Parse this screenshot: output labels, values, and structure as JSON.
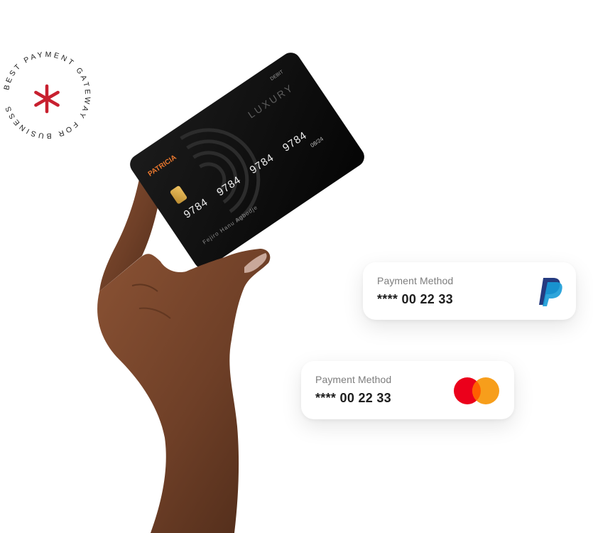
{
  "badge": {
    "ring_text": "BEST PAYMENT GATEWAY FOR BUSINESS",
    "accent_color": "#c8202f",
    "icon": "asterisk-icon"
  },
  "debit_card": {
    "type_label": "DEBIT",
    "tier_label": "LUXURY",
    "brand": "PATRICIA",
    "number_groups": [
      "9784",
      "9784",
      "9784",
      "9784"
    ],
    "expiry": "08/24",
    "holder_name": "Fejiro Hanu Agbodje",
    "card_color": "#0e0e0e",
    "brand_color": "#e8772e",
    "chip_icon": "chip-icon"
  },
  "payment_cards": [
    {
      "label": "Payment Method",
      "number": "**** 00 22 33",
      "logo": "paypal-icon",
      "colors": [
        "#253b80",
        "#179bd7"
      ]
    },
    {
      "label": "Payment Method",
      "number": "**** 00 22 33",
      "logo": "mastercard-icon",
      "colors": [
        "#eb001b",
        "#f79e1b",
        "#ff5f00"
      ]
    }
  ]
}
